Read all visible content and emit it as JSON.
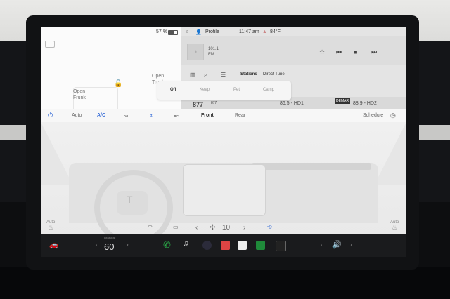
{
  "car": {
    "frunk_label": "Open\nFrunk",
    "trunk_label": "Open\nTrunk",
    "lock_icon": "unlocked-padlock-icon"
  },
  "status_bar": {
    "battery_percent": "57 %",
    "battery_level": 0.57,
    "profile_label": "Profile",
    "time": "11:47 am",
    "outside_temp": "84°F"
  },
  "media": {
    "station_line1": "101.1",
    "station_line2": "FM",
    "icons": [
      "favorite-star-icon",
      "previous-track-icon",
      "stop-icon",
      "next-track-icon"
    ]
  },
  "media_tabs": {
    "stations": "Stations",
    "direct_tune": "Direct Tune",
    "icons": [
      "library-icon",
      "search-icon",
      "equalizer-icon"
    ]
  },
  "media_list": {
    "freq": "877",
    "item_a": "877",
    "item_b": "86.5 - HD1",
    "item_c": "88.9 - HD2",
    "badge": "DEMAR"
  },
  "climate_mode": {
    "off": "Off",
    "keep": "Keep",
    "pet": "Pet",
    "camp": "Camp"
  },
  "climate": {
    "power_icon": "power-icon",
    "auto": "Auto",
    "ac": "A/C",
    "front": "Front",
    "rear": "Rear",
    "schedule": "Schedule"
  },
  "seats": {
    "left_label": "Auto",
    "right_label": "Auto"
  },
  "fan": {
    "speed": "10",
    "left_arrow": "‹",
    "right_arrow": "›"
  },
  "dock": {
    "temp_label": "Manual",
    "temp": "60",
    "apps": [
      "phone-icon",
      "music-icon",
      "camera-icon",
      "toybox-icon",
      "calendar-icon",
      "energy-icon",
      "theater-icon"
    ],
    "volume_icon": "volume-icon"
  },
  "colors": {
    "accent_blue": "#3a6fd8",
    "phone_green": "#2bb34a"
  }
}
